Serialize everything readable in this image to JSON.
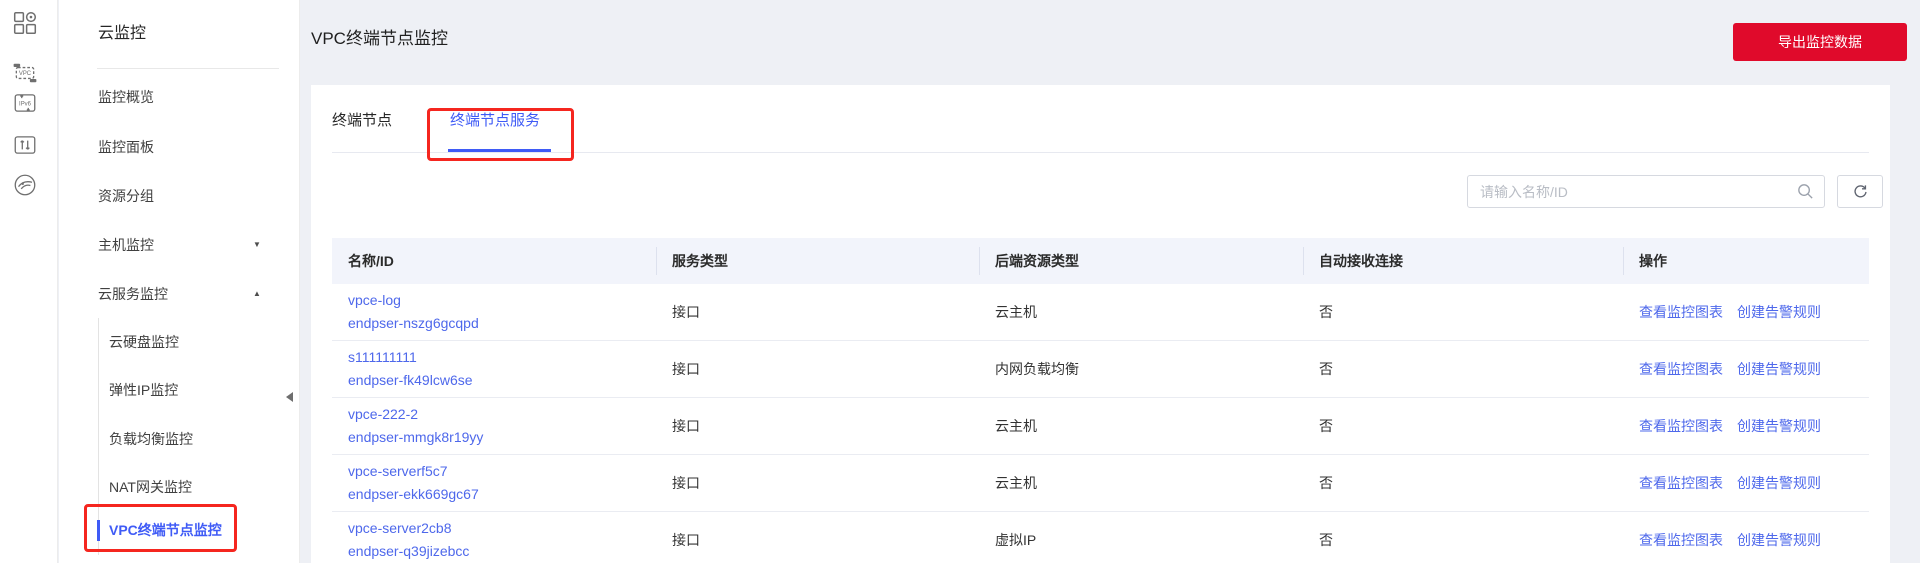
{
  "colors": {
    "primary_blue": "#3f5bf6",
    "link_blue": "#4e68eb",
    "button_red": "#e00a2b",
    "annotation_red": "#f5261f"
  },
  "icon_rail": {
    "icons": [
      "apps",
      "vpc",
      "ipv6-gateway",
      "elastic-ip",
      "service-globe"
    ]
  },
  "sidebar": {
    "title": "云监控",
    "items": [
      {
        "label": "监控概览"
      },
      {
        "label": "监控面板"
      },
      {
        "label": "资源分组"
      },
      {
        "label": "主机监控",
        "arrow": "▼"
      },
      {
        "label": "云服务监控",
        "arrow": "▲"
      }
    ],
    "subitems": [
      {
        "label": "云硬盘监控"
      },
      {
        "label": "弹性IP监控"
      },
      {
        "label": "负载均衡监控"
      },
      {
        "label": "NAT网关监控"
      },
      {
        "label": "VPC终端节点监控",
        "active": true
      }
    ]
  },
  "header": {
    "title": "VPC终端节点监控",
    "export_button": "导出监控数据"
  },
  "tabs": [
    {
      "label": "终端节点",
      "active": false
    },
    {
      "label": "终端节点服务",
      "active": true
    }
  ],
  "search": {
    "placeholder": "请输入名称/ID"
  },
  "table": {
    "columns": [
      "名称/ID",
      "服务类型",
      "后端资源类型",
      "自动接收连接",
      "操作"
    ],
    "actions": [
      "查看监控图表",
      "创建告警规则"
    ],
    "rows": [
      {
        "name": "vpce-log",
        "id": "endpser-nszg6gcqpd",
        "service_type": "接口",
        "backend_type": "云主机",
        "auto_accept": "否"
      },
      {
        "name": "s111111111",
        "id": "endpser-fk49lcw6se",
        "service_type": "接口",
        "backend_type": "内网负载均衡",
        "auto_accept": "否"
      },
      {
        "name": "vpce-222-2",
        "id": "endpser-mmgk8r19yy",
        "service_type": "接口",
        "backend_type": "云主机",
        "auto_accept": "否"
      },
      {
        "name": "vpce-serverf5c7",
        "id": "endpser-ekk669gc67",
        "service_type": "接口",
        "backend_type": "云主机",
        "auto_accept": "否"
      },
      {
        "name": "vpce-server2cb8",
        "id": "endpser-q39jizebcc",
        "service_type": "接口",
        "backend_type": "虚拟IP",
        "auto_accept": "否"
      }
    ]
  }
}
